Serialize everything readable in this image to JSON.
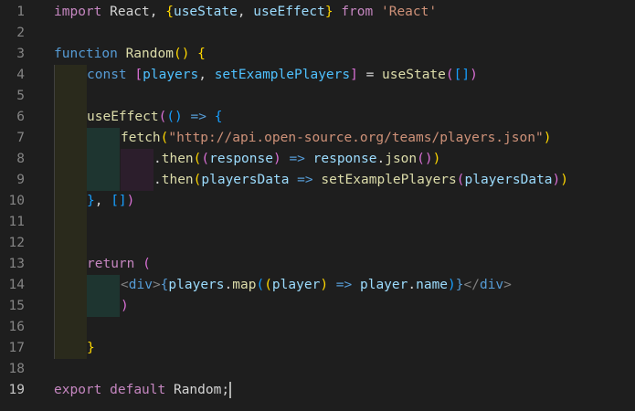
{
  "editor": {
    "active_line": 19,
    "colors": {
      "background": "#1e1e1e",
      "keyword": "#c586c0",
      "storage": "#569cd6",
      "function": "#dcdcaa",
      "variable": "#9cdcfe",
      "constant": "#4fc1ff",
      "string": "#ce9178",
      "plain": "#d4d4d4",
      "tag_punctuation": "#808080",
      "bracket_level_1": "#ffd700",
      "bracket_level_2": "#da70d6",
      "bracket_level_3": "#179fff",
      "line_number": "#858585"
    },
    "lines": [
      {
        "n": "1",
        "depth": 0,
        "tokens": [
          [
            "kw",
            "import"
          ],
          [
            "pl",
            " React, "
          ],
          [
            "b1",
            "{"
          ],
          [
            "vr",
            "useState"
          ],
          [
            "pl",
            ", "
          ],
          [
            "vr",
            "useEffect"
          ],
          [
            "b1",
            "}"
          ],
          [
            "pl",
            " "
          ],
          [
            "kw",
            "from"
          ],
          [
            "pl",
            " "
          ],
          [
            "str",
            "'React'"
          ]
        ]
      },
      {
        "n": "2",
        "depth": 0,
        "tokens": []
      },
      {
        "n": "3",
        "depth": 0,
        "tokens": [
          [
            "st",
            "function"
          ],
          [
            "pl",
            " "
          ],
          [
            "fn",
            "Random"
          ],
          [
            "b1",
            "()"
          ],
          [
            "pl",
            " "
          ],
          [
            "b1",
            "{"
          ]
        ]
      },
      {
        "n": "4",
        "depth": 1,
        "tokens": [
          [
            "st",
            "const"
          ],
          [
            "pl",
            " "
          ],
          [
            "b2",
            "["
          ],
          [
            "cn",
            "players"
          ],
          [
            "pl",
            ", "
          ],
          [
            "cn",
            "setExamplePlayers"
          ],
          [
            "b2",
            "]"
          ],
          [
            "pl",
            " = "
          ],
          [
            "fn",
            "useState"
          ],
          [
            "b2",
            "("
          ],
          [
            "b3",
            "[]"
          ],
          [
            "b2",
            ")"
          ]
        ]
      },
      {
        "n": "5",
        "depth": 1,
        "tokens": []
      },
      {
        "n": "6",
        "depth": 1,
        "tokens": [
          [
            "fn",
            "useEffect"
          ],
          [
            "b2",
            "("
          ],
          [
            "b3",
            "()"
          ],
          [
            "pl",
            " "
          ],
          [
            "st",
            "=>"
          ],
          [
            "pl",
            " "
          ],
          [
            "b3",
            "{"
          ]
        ]
      },
      {
        "n": "7",
        "depth": 2,
        "tokens": [
          [
            "fn",
            "fetch"
          ],
          [
            "b1",
            "("
          ],
          [
            "str",
            "\"http://api.open-source.org/teams/players.json\""
          ],
          [
            "b1",
            ")"
          ]
        ]
      },
      {
        "n": "8",
        "depth": 3,
        "tokens": [
          [
            "pl",
            "."
          ],
          [
            "fn",
            "then"
          ],
          [
            "b1",
            "("
          ],
          [
            "b2",
            "("
          ],
          [
            "vr",
            "response"
          ],
          [
            "b2",
            ")"
          ],
          [
            "pl",
            " "
          ],
          [
            "st",
            "=>"
          ],
          [
            "pl",
            " "
          ],
          [
            "vr",
            "response"
          ],
          [
            "pl",
            "."
          ],
          [
            "fn",
            "json"
          ],
          [
            "b2",
            "()"
          ],
          [
            "b1",
            ")"
          ]
        ]
      },
      {
        "n": "9",
        "depth": 3,
        "tokens": [
          [
            "pl",
            "."
          ],
          [
            "fn",
            "then"
          ],
          [
            "b1",
            "("
          ],
          [
            "vr",
            "playersData"
          ],
          [
            "pl",
            " "
          ],
          [
            "st",
            "=>"
          ],
          [
            "pl",
            " "
          ],
          [
            "fn",
            "setExamplePlayers"
          ],
          [
            "b2",
            "("
          ],
          [
            "vr",
            "playersData"
          ],
          [
            "b2",
            ")"
          ],
          [
            "b1",
            ")"
          ]
        ]
      },
      {
        "n": "10",
        "depth": 1,
        "tokens": [
          [
            "b3",
            "}"
          ],
          [
            "pl",
            ", "
          ],
          [
            "b3",
            "[]"
          ],
          [
            "b2",
            ")"
          ]
        ]
      },
      {
        "n": "11",
        "depth": 1,
        "tokens": []
      },
      {
        "n": "12",
        "depth": 1,
        "tokens": []
      },
      {
        "n": "13",
        "depth": 1,
        "tokens": [
          [
            "kw",
            "return"
          ],
          [
            "pl",
            " "
          ],
          [
            "b2",
            "("
          ]
        ]
      },
      {
        "n": "14",
        "depth": 2,
        "tokens": [
          [
            "tg",
            "<"
          ],
          [
            "st",
            "div"
          ],
          [
            "tg",
            ">"
          ],
          [
            "st",
            "{"
          ],
          [
            "vr",
            "players"
          ],
          [
            "pl",
            "."
          ],
          [
            "fn",
            "map"
          ],
          [
            "b3",
            "("
          ],
          [
            "b1",
            "("
          ],
          [
            "vr",
            "player"
          ],
          [
            "b1",
            ")"
          ],
          [
            "pl",
            " "
          ],
          [
            "st",
            "=>"
          ],
          [
            "pl",
            " "
          ],
          [
            "vr",
            "player"
          ],
          [
            "pl",
            "."
          ],
          [
            "vr",
            "name"
          ],
          [
            "b3",
            ")"
          ],
          [
            "st",
            "}"
          ],
          [
            "tg",
            "</"
          ],
          [
            "st",
            "div"
          ],
          [
            "tg",
            ">"
          ]
        ]
      },
      {
        "n": "15",
        "depth": 2,
        "tokens": [
          [
            "b2",
            ")"
          ]
        ]
      },
      {
        "n": "16",
        "depth": 1,
        "tokens": []
      },
      {
        "n": "17",
        "depth": 1,
        "tokens": [
          [
            "b1",
            "}"
          ]
        ]
      },
      {
        "n": "18",
        "depth": 0,
        "tokens": []
      },
      {
        "n": "19",
        "depth": 0,
        "cursor": true,
        "tokens": [
          [
            "kw",
            "export"
          ],
          [
            "pl",
            " "
          ],
          [
            "kw",
            "default"
          ],
          [
            "pl",
            " Random;"
          ]
        ]
      }
    ]
  }
}
